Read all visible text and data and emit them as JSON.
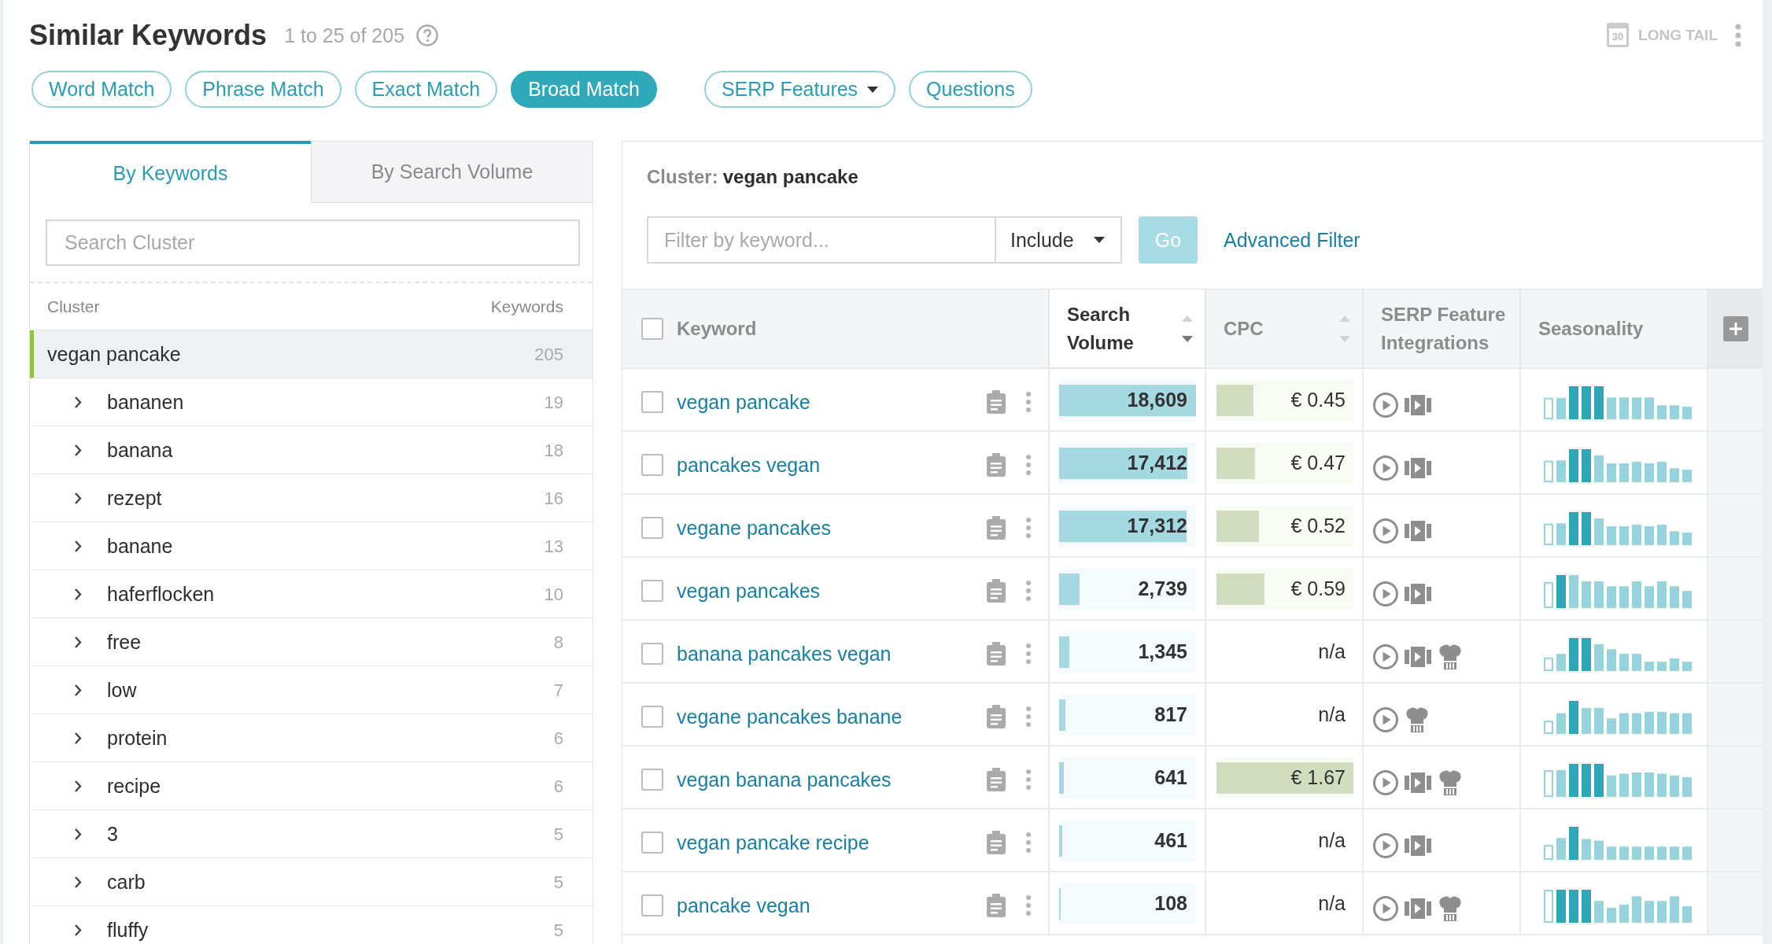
{
  "header": {
    "title": "Similar Keywords",
    "result_count": "1 to 25 of 205",
    "long_tail": {
      "label": "LONG TAIL",
      "calendar_day": "30"
    }
  },
  "match_types": [
    {
      "label": "Word Match",
      "selected": false
    },
    {
      "label": "Phrase Match",
      "selected": false
    },
    {
      "label": "Exact Match",
      "selected": false
    },
    {
      "label": "Broad Match",
      "selected": true
    }
  ],
  "extra_filters": [
    {
      "label": "SERP Features",
      "kind": "dropdown"
    },
    {
      "label": "Questions",
      "kind": "button"
    }
  ],
  "cluster_tabs": [
    {
      "label": "By Keywords",
      "selected": true
    },
    {
      "label": "By Search Volume",
      "selected": false
    }
  ],
  "cluster_search": {
    "placeholder": "Search Cluster"
  },
  "cluster_list": {
    "columns": [
      "Cluster",
      "Keywords"
    ],
    "items": [
      {
        "name": "vegan pancake",
        "count": "205",
        "selected": true,
        "children": [
          {
            "name": "bananen",
            "count": "19",
            "selected": false,
            "expanded": false
          },
          {
            "name": "banana",
            "count": "18",
            "selected": false,
            "expanded": false
          },
          {
            "name": "rezept",
            "count": "16",
            "selected": false,
            "expanded": false
          },
          {
            "name": "banane",
            "count": "13",
            "selected": false,
            "expanded": false
          },
          {
            "name": "haferflocken",
            "count": "10",
            "selected": false,
            "expanded": false
          },
          {
            "name": "free",
            "count": "8",
            "selected": false,
            "expanded": false
          },
          {
            "name": "low",
            "count": "7",
            "selected": false,
            "expanded": false
          },
          {
            "name": "protein",
            "count": "6",
            "selected": false,
            "expanded": false
          },
          {
            "name": "recipe",
            "count": "6",
            "selected": false,
            "expanded": false
          },
          {
            "name": "3",
            "count": "5",
            "selected": false,
            "expanded": false
          },
          {
            "name": "carb",
            "count": "5",
            "selected": false,
            "expanded": false
          },
          {
            "name": "fluffy",
            "count": "5",
            "selected": false,
            "expanded": false
          }
        ]
      }
    ]
  },
  "cluster_heading": {
    "label": "Cluster:",
    "name": "vegan pancake"
  },
  "keyword_filter": {
    "placeholder": "Filter by keyword...",
    "mode": "Include",
    "go": {
      "label": "Go",
      "disabled": true
    },
    "advanced": "Advanced Filter"
  },
  "table": {
    "select_all": {
      "checked": false
    },
    "columns": [
      {
        "label": "Keyword"
      },
      {
        "label": "Search Volume",
        "sorted": true
      },
      {
        "label": "CPC",
        "sorted": false
      },
      {
        "label": "SERP Feature Integrations"
      },
      {
        "label": "Seasonality"
      }
    ],
    "rows": [
      {
        "keyword": "vegan pancake",
        "checked": false,
        "volume": {
          "value": "18,609",
          "level": 1
        },
        "cpc": {
          "value": "€ 0.45",
          "level": 0.27
        },
        "serp_features": [
          {
            "kind": "video"
          },
          {
            "kind": "video_carousel"
          }
        ]
      },
      {
        "keyword": "pancakes vegan",
        "checked": false,
        "volume": {
          "value": "17,412",
          "level": 0.936
        },
        "cpc": {
          "value": "€ 0.47",
          "level": 0.28
        },
        "serp_features": [
          {
            "kind": "video"
          },
          {
            "kind": "video_carousel"
          }
        ]
      },
      {
        "keyword": "vegane pancakes",
        "checked": false,
        "volume": {
          "value": "17,312",
          "level": 0.93
        },
        "cpc": {
          "value": "€ 0.52",
          "level": 0.31
        },
        "serp_features": [
          {
            "kind": "video"
          },
          {
            "kind": "video_carousel"
          }
        ]
      },
      {
        "keyword": "vegan pancakes",
        "checked": false,
        "volume": {
          "value": "2,739",
          "level": 0.147
        },
        "cpc": {
          "value": "€ 0.59",
          "level": 0.35
        },
        "serp_features": [
          {
            "kind": "video"
          },
          {
            "kind": "video_carousel"
          }
        ]
      },
      {
        "keyword": "banana pancakes vegan",
        "checked": false,
        "volume": {
          "value": "1,345",
          "level": 0.072
        },
        "cpc": {
          "value": "n/a"
        },
        "serp_features": [
          {
            "kind": "video"
          },
          {
            "kind": "video_carousel"
          },
          {
            "kind": "recipes"
          }
        ]
      },
      {
        "keyword": "vegane pancakes banane",
        "checked": false,
        "volume": {
          "value": "817",
          "level": 0.044
        },
        "cpc": {
          "value": "n/a"
        },
        "serp_features": [
          {
            "kind": "video"
          },
          {
            "kind": "recipes"
          }
        ]
      },
      {
        "keyword": "vegan banana pancakes",
        "checked": false,
        "volume": {
          "value": "641",
          "level": 0.034
        },
        "cpc": {
          "value": "€ 1.67",
          "level": 1
        },
        "serp_features": [
          {
            "kind": "video"
          },
          {
            "kind": "video_carousel"
          },
          {
            "kind": "recipes"
          }
        ]
      },
      {
        "keyword": "vegan pancake recipe",
        "checked": false,
        "volume": {
          "value": "461",
          "level": 0.025
        },
        "cpc": {
          "value": "n/a"
        },
        "serp_features": [
          {
            "kind": "video"
          },
          {
            "kind": "video_carousel"
          }
        ]
      },
      {
        "keyword": "pancake vegan",
        "checked": false,
        "volume": {
          "value": "108",
          "level": 0.006
        },
        "cpc": {
          "value": "n/a"
        },
        "serp_features": [
          {
            "kind": "video"
          },
          {
            "kind": "video_carousel"
          },
          {
            "kind": "recipes"
          }
        ]
      }
    ]
  }
}
